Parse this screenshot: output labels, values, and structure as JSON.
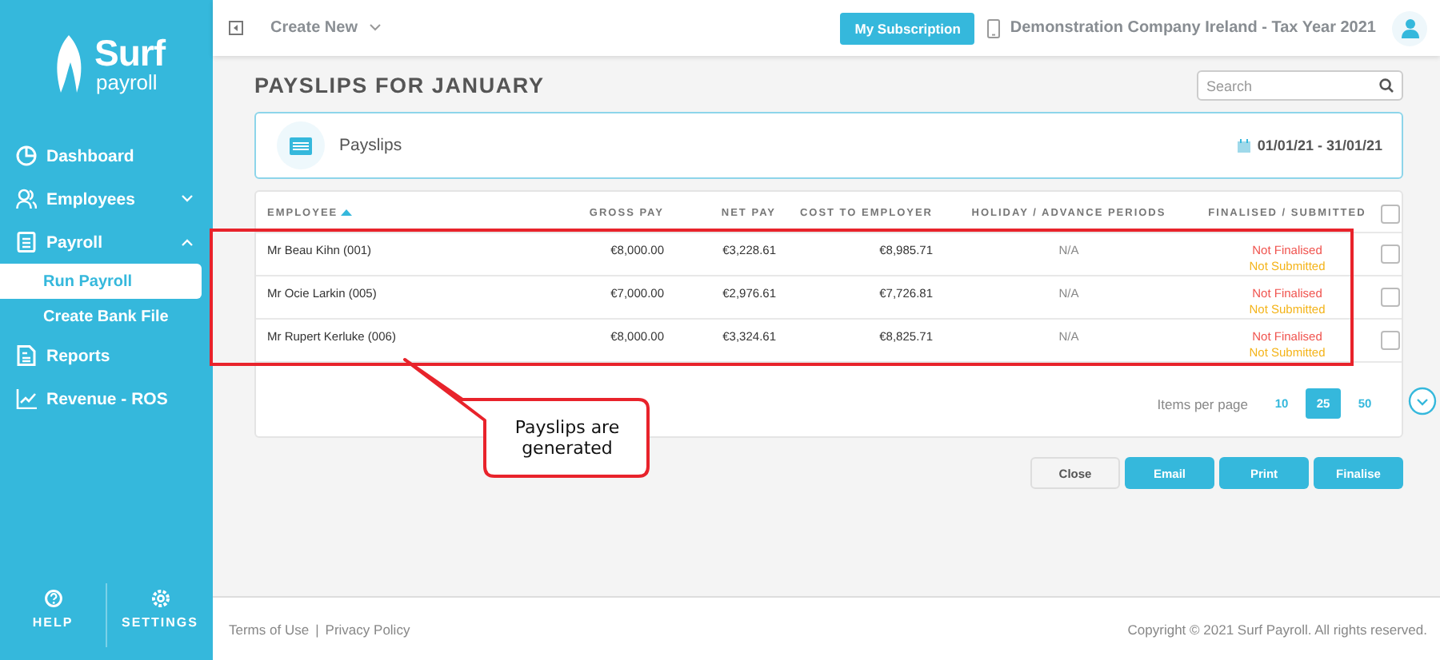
{
  "sidebar": {
    "logo": {
      "brand": "Surf",
      "sub": "payroll"
    },
    "items": [
      {
        "label": "Dashboard"
      },
      {
        "label": "Employees",
        "expanded": false
      },
      {
        "label": "Payroll",
        "expanded": true,
        "children": [
          {
            "label": "Run Payroll",
            "selected": true
          },
          {
            "label": "Create Bank File",
            "selected": false
          }
        ]
      },
      {
        "label": "Reports"
      },
      {
        "label": "Revenue - ROS"
      }
    ],
    "bottom": [
      {
        "label": "HELP"
      },
      {
        "label": "SETTINGS"
      }
    ]
  },
  "topbar": {
    "create_new": "Create New",
    "subscription_button": "My Subscription",
    "company": "Demonstration Company Ireland - Tax Year 2021"
  },
  "page_title": "PAYSLIPS FOR JANUARY",
  "search": {
    "placeholder": "Search"
  },
  "card": {
    "title": "Payslips",
    "date_range": "01/01/21 - 31/01/21"
  },
  "table": {
    "columns": [
      {
        "label": "EMPLOYEE",
        "sorted": true
      },
      {
        "label": "GROSS PAY"
      },
      {
        "label": "NET PAY"
      },
      {
        "label": "COST TO EMPLOYER"
      },
      {
        "label": "HOLIDAY / ADVANCE PERIODS"
      },
      {
        "label": "FINALISED / SUBMITTED"
      }
    ],
    "all_checked": false,
    "rows": [
      {
        "employee": "Mr Beau Kihn (001)",
        "gross_pay": "€8,000.00",
        "net_pay": "€3,228.61",
        "cost_to_employer": "€8,985.71",
        "holiday": "N/A",
        "finalised": "Not Finalised",
        "submitted": "Not Submitted",
        "checked": false
      },
      {
        "employee": "Mr Ocie Larkin (005)",
        "gross_pay": "€7,000.00",
        "net_pay": "€2,976.61",
        "cost_to_employer": "€7,726.81",
        "holiday": "N/A",
        "finalised": "Not Finalised",
        "submitted": "Not Submitted",
        "checked": false
      },
      {
        "employee": "Mr Rupert Kerluke (006)",
        "gross_pay": "€8,000.00",
        "net_pay": "€3,324.61",
        "cost_to_employer": "€8,825.71",
        "holiday": "N/A",
        "finalised": "Not Finalised",
        "submitted": "Not Submitted",
        "checked": false
      }
    ]
  },
  "pagination": {
    "label": "Items per page",
    "options": [
      {
        "label": "10",
        "selected": false
      },
      {
        "label": "25",
        "selected": true
      },
      {
        "label": "50",
        "selected": false
      }
    ]
  },
  "buttons": [
    {
      "label": "Close",
      "kind": "secondary"
    },
    {
      "label": "Email",
      "kind": "primary"
    },
    {
      "label": "Print",
      "kind": "primary"
    },
    {
      "label": "Finalise",
      "kind": "primary"
    }
  ],
  "annotation": {
    "text": "Payslips are generated"
  },
  "footer": {
    "links": [
      "Terms of Use",
      "Privacy Policy"
    ],
    "separator": "|",
    "copyright": "Copyright © 2021 Surf Payroll. All rights reserved."
  }
}
